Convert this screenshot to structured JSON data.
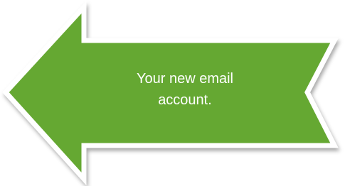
{
  "callout": {
    "line1": "Your new email",
    "line2": "account.",
    "icon": "left-arrow-icon",
    "fill_color": "#65a832",
    "border_color": "#ffffff"
  }
}
